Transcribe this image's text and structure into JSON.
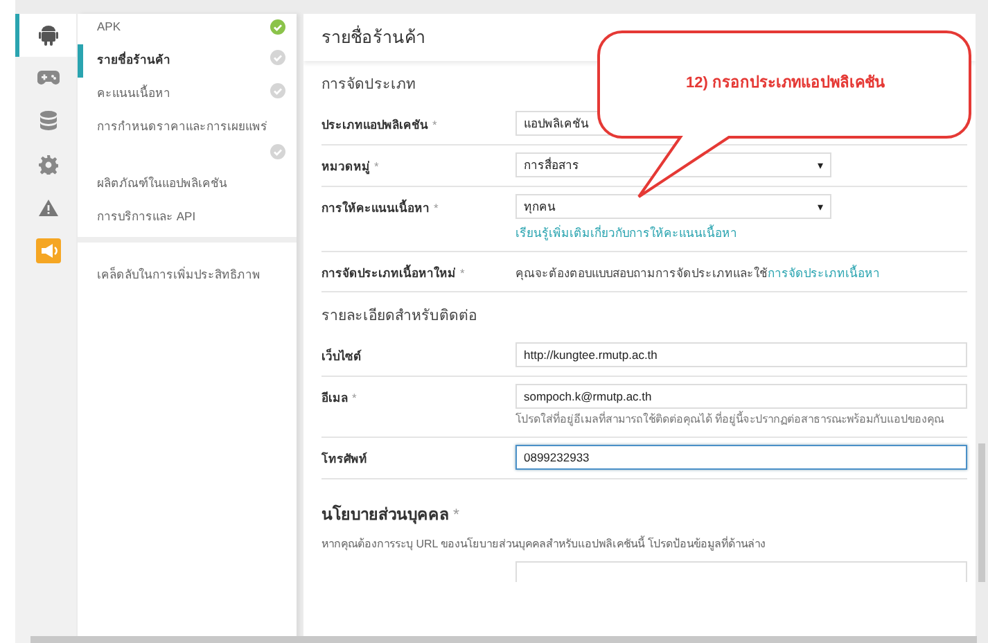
{
  "rail": [
    {
      "kind": "android",
      "selected": true
    },
    {
      "kind": "gamepad",
      "selected": false
    },
    {
      "kind": "database",
      "selected": false
    },
    {
      "kind": "gear",
      "selected": false
    },
    {
      "kind": "warning",
      "selected": false
    },
    {
      "kind": "megaphone",
      "selected": false
    }
  ],
  "nav": {
    "items": [
      {
        "label": "APK",
        "selected": false,
        "kind": "step",
        "complete": true
      },
      {
        "label": "รายชื่อร้านค้า",
        "selected": true,
        "kind": "step",
        "complete": false
      },
      {
        "label": "คะแนนเนื้อหา",
        "selected": false,
        "kind": "step",
        "complete": false
      },
      {
        "label": "การกำหนดราคาและการเผยแพร่",
        "selected": false,
        "kind": "step",
        "complete": false
      },
      {
        "label": "ผลิตภัณฑ์ในแอปพลิเคชัน",
        "selected": false,
        "kind": "plain"
      },
      {
        "label": "การบริการและ API",
        "selected": false,
        "kind": "plain"
      }
    ],
    "footer_items": [
      {
        "label": "เคล็ดลับในการเพิ่มประสิทธิภาพ",
        "selected": false
      }
    ]
  },
  "page_title": "รายชื่อร้านค้า",
  "sections": [
    {
      "heading": "การจัดประเภท",
      "rows": [
        {
          "label": "ประเภทแอปพลิเคชัน",
          "required_mark": "*",
          "kind": "select",
          "value": "แอปพลิเคชัน",
          "arrow": "",
          "focused": false
        },
        {
          "label": "หมวดหมู่",
          "required_mark": "*",
          "kind": "select",
          "value": "การสื่อสาร",
          "arrow": "▾",
          "focused": false
        },
        {
          "label": "การให้คะแนนเนื้อหา",
          "required_mark": "*",
          "kind": "select",
          "value": "ทุกคน",
          "arrow": "▾",
          "focused": false,
          "link": "เรียนรู้เพิ่มเติมเกี่ยวกับการให้คะแนนเนื้อหา"
        },
        {
          "label": "การจัดประเภทเนื้อหาใหม่",
          "required_mark": "*",
          "kind": "text",
          "text": "คุณจะต้องตอบแบบสอบถามการจัดประเภทและใช้",
          "link": "การจัดประเภทเนื้อหา"
        }
      ]
    },
    {
      "heading": "รายละเอียดสำหรับติดต่อ",
      "rows": [
        {
          "label": "เว็บไซต์",
          "kind": "input",
          "value": "http://kungtee.rmutp.ac.th",
          "focused": false
        },
        {
          "label": "อีเมล",
          "required_mark": "*",
          "kind": "input",
          "value": "sompoch.k@rmutp.ac.th",
          "focused": false,
          "help": "โปรดใส่ที่อยู่อีเมลที่สามารถใช้ติดต่อคุณได้ ที่อยู่นี้จะปรากฏต่อสาธารณะพร้อมกับแอปของคุณ"
        },
        {
          "label": "โทรศัพท์",
          "kind": "input",
          "value": "0899232933",
          "focused": true
        }
      ]
    }
  ],
  "privacy": {
    "heading": "นโยบายส่วนบุคคล",
    "required_mark": "*",
    "description": "หากคุณต้องการระบุ URL ของนโยบายส่วนบุคคลสำหรับแอปพลิเคชันนี้ โปรดป้อนข้อมูลที่ด้านล่าง"
  },
  "callout": {
    "text": "12) กรอกประเภทแอปพลิเคชัน"
  }
}
